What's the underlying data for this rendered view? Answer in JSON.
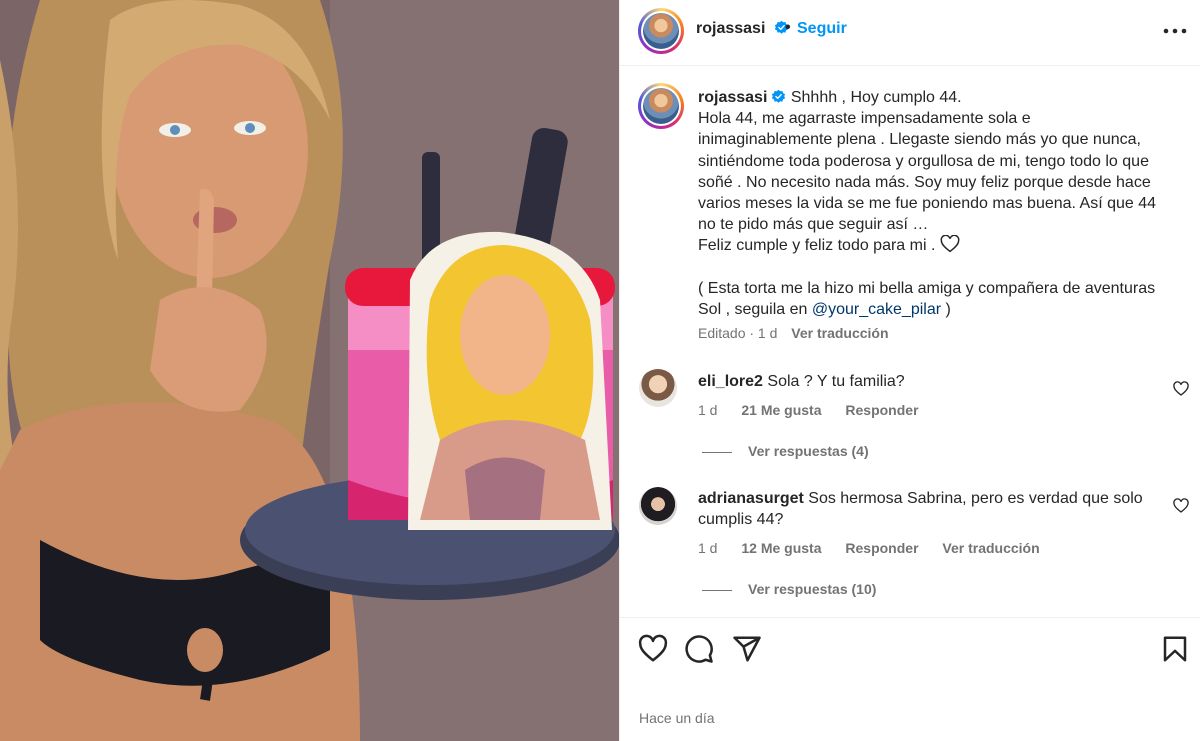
{
  "post": {
    "username": "rojassasi",
    "follow_label": "Seguir",
    "separator": "•"
  },
  "caption": {
    "username": "rojassasi",
    "lines": [
      "Shhhh , Hoy cumplo 44.",
      "Hola 44, me agarraste impensadamente sola e",
      "inimaginablemente plena . Llegaste siendo más yo que nunca,",
      "sintiéndome toda poderosa y orgullosa de mi, tengo todo lo que",
      "soñé . No necesito nada más. Soy muy feliz porque desde hace",
      "varios meses la vida se me fue poniendo mas buena. Así que 44",
      "no te pido más que seguir así …",
      "Feliz cumple y feliz todo para mi .",
      "",
      "( Esta torta me la hizo mi bella amiga y compañera de aventuras",
      "Sol , seguila en"
    ],
    "mention": "@your_cake_pilar",
    "closing": " )",
    "edited": "Editado · 1 d",
    "translate": "Ver traducción"
  },
  "comments": [
    {
      "username": "eli_lore2",
      "text": "Sola ? Y tu familia?",
      "time": "1 d",
      "likes": "21 Me gusta",
      "reply": "Responder",
      "replies": "Ver respuestas (4)"
    },
    {
      "username": "adrianasurget",
      "text": "Sos hermosa Sabrina, pero es verdad que solo cumplis 44?",
      "time": "1 d",
      "likes": "12 Me gusta",
      "reply": "Responder",
      "translate": "Ver traducción",
      "replies": "Ver respuestas (10)"
    }
  ],
  "footer": {
    "posted": "Hace un día"
  },
  "icons": {
    "verified": "verified-badge-icon",
    "more": "more-options-icon",
    "like": "heart-icon",
    "comment": "comment-bubble-icon",
    "share": "paper-plane-icon",
    "save": "bookmark-icon"
  },
  "colors": {
    "link": "#0095f6",
    "mention": "#00376b",
    "muted": "#737373",
    "text": "#262626"
  }
}
